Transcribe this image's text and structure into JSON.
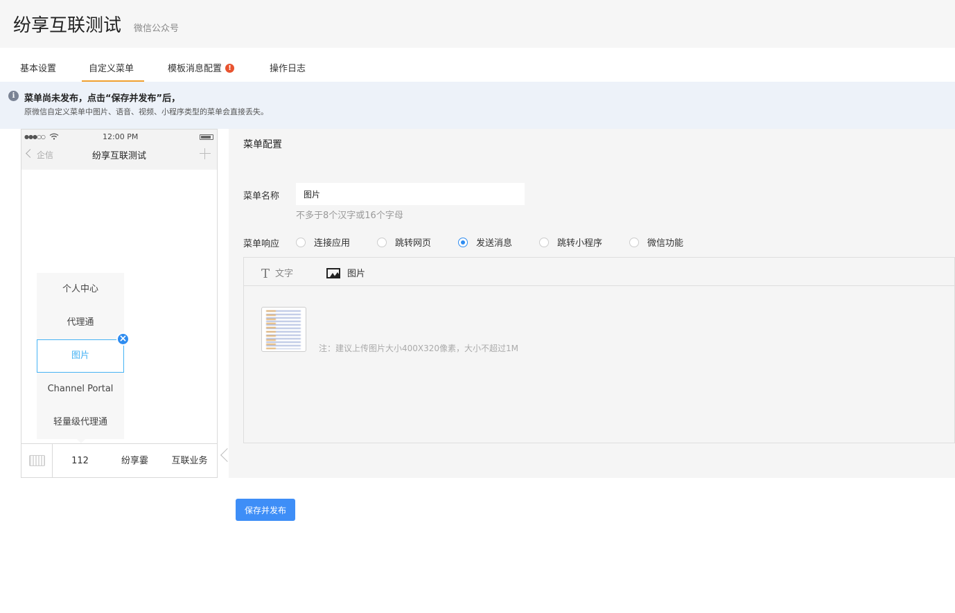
{
  "header": {
    "title": "纷享互联测试",
    "subtitle": "微信公众号"
  },
  "tabs": [
    {
      "label": "基本设置",
      "active": false
    },
    {
      "label": "自定义菜单",
      "active": true
    },
    {
      "label": "模板消息配置",
      "active": false,
      "badge": "!"
    },
    {
      "label": "操作日志",
      "active": false
    }
  ],
  "notice": {
    "icon": "info-icon",
    "title": "菜单尚未发布，点击“保存并发布”后，",
    "text": "原微信自定义菜单中图片、语音、视频、小程序类型的菜单会直接丢失。"
  },
  "phone": {
    "signal": "●●●○○",
    "time": "12:00 PM",
    "back_label": "企信",
    "title": "纷享互联测试",
    "submenu": [
      "个人中心",
      "代理通",
      "图片",
      "Channel Portal",
      "轻量级代理通"
    ],
    "selected_submenu": "图片",
    "bottom_menu": [
      "112",
      "纷享霎",
      "互联业务"
    ]
  },
  "config": {
    "title": "菜单配置",
    "name_label": "菜单名称",
    "name_value": "图片",
    "name_hint": "不多于8个汉字或16个字母",
    "response_label": "菜单响应",
    "response_options": [
      "连接应用",
      "跳转网页",
      "发送消息",
      "跳转小程序",
      "微信功能"
    ],
    "response_selected": "发送消息",
    "message_tabs": [
      "文字",
      "图片"
    ],
    "message_active_tab": "图片",
    "upload_note": "注：建议上传图片大小400X320像素，大小不超过1M"
  },
  "actions": {
    "publish_label": "保存并发布"
  },
  "colors": {
    "accent": "#3e8ef7",
    "tab_underline": "#f0a02f",
    "selected_border": "#44b2f4",
    "badge": "#e8532f"
  }
}
